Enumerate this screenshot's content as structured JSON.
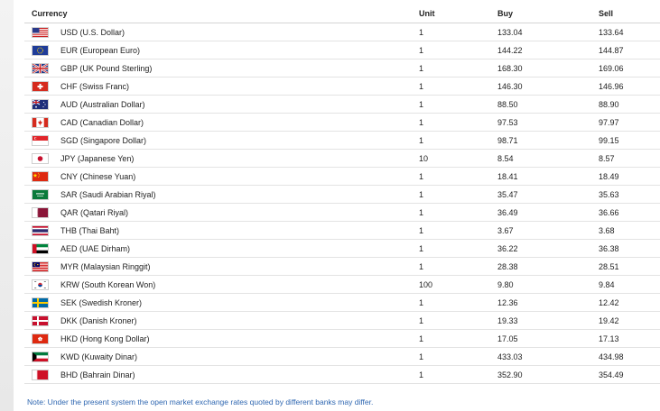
{
  "table": {
    "headers": {
      "currency": "Currency",
      "unit": "Unit",
      "buy": "Buy",
      "sell": "Sell"
    },
    "rows": [
      {
        "flag": "us-flag-icon",
        "name": "USD (U.S. Dollar)",
        "unit": "1",
        "buy": "133.04",
        "sell": "133.64"
      },
      {
        "flag": "eu-flag-icon",
        "name": "EUR (European Euro)",
        "unit": "1",
        "buy": "144.22",
        "sell": "144.87"
      },
      {
        "flag": "uk-flag-icon",
        "name": "GBP (UK Pound Sterling)",
        "unit": "1",
        "buy": "168.30",
        "sell": "169.06"
      },
      {
        "flag": "ch-flag-icon",
        "name": "CHF (Swiss Franc)",
        "unit": "1",
        "buy": "146.30",
        "sell": "146.96"
      },
      {
        "flag": "au-flag-icon",
        "name": "AUD (Australian Dollar)",
        "unit": "1",
        "buy": "88.50",
        "sell": "88.90"
      },
      {
        "flag": "ca-flag-icon",
        "name": "CAD (Canadian Dollar)",
        "unit": "1",
        "buy": "97.53",
        "sell": "97.97"
      },
      {
        "flag": "sg-flag-icon",
        "name": "SGD (Singapore Dollar)",
        "unit": "1",
        "buy": "98.71",
        "sell": "99.15"
      },
      {
        "flag": "jp-flag-icon",
        "name": "JPY (Japanese Yen)",
        "unit": "10",
        "buy": "8.54",
        "sell": "8.57"
      },
      {
        "flag": "cn-flag-icon",
        "name": "CNY (Chinese Yuan)",
        "unit": "1",
        "buy": "18.41",
        "sell": "18.49"
      },
      {
        "flag": "sa-flag-icon",
        "name": "SAR (Saudi Arabian Riyal)",
        "unit": "1",
        "buy": "35.47",
        "sell": "35.63"
      },
      {
        "flag": "qa-flag-icon",
        "name": "QAR (Qatari Riyal)",
        "unit": "1",
        "buy": "36.49",
        "sell": "36.66"
      },
      {
        "flag": "th-flag-icon",
        "name": "THB (Thai Baht)",
        "unit": "1",
        "buy": "3.67",
        "sell": "3.68"
      },
      {
        "flag": "ae-flag-icon",
        "name": "AED (UAE Dirham)",
        "unit": "1",
        "buy": "36.22",
        "sell": "36.38"
      },
      {
        "flag": "my-flag-icon",
        "name": "MYR (Malaysian Ringgit)",
        "unit": "1",
        "buy": "28.38",
        "sell": "28.51"
      },
      {
        "flag": "kr-flag-icon",
        "name": "KRW (South Korean Won)",
        "unit": "100",
        "buy": "9.80",
        "sell": "9.84"
      },
      {
        "flag": "se-flag-icon",
        "name": "SEK (Swedish Kroner)",
        "unit": "1",
        "buy": "12.36",
        "sell": "12.42"
      },
      {
        "flag": "dk-flag-icon",
        "name": "DKK (Danish Kroner)",
        "unit": "1",
        "buy": "19.33",
        "sell": "19.42"
      },
      {
        "flag": "hk-flag-icon",
        "name": "HKD (Hong Kong Dollar)",
        "unit": "1",
        "buy": "17.05",
        "sell": "17.13"
      },
      {
        "flag": "kw-flag-icon",
        "name": "KWD (Kuwaity Dinar)",
        "unit": "1",
        "buy": "433.03",
        "sell": "434.98"
      },
      {
        "flag": "bh-flag-icon",
        "name": "BHD (Bahrain Dinar)",
        "unit": "1",
        "buy": "352.90",
        "sell": "354.49"
      }
    ]
  },
  "note": "Note: Under the present system the open market exchange rates quoted by different banks may differ.",
  "colors": {
    "note": "#2f67b1",
    "row_border": "#e3e3e3"
  }
}
